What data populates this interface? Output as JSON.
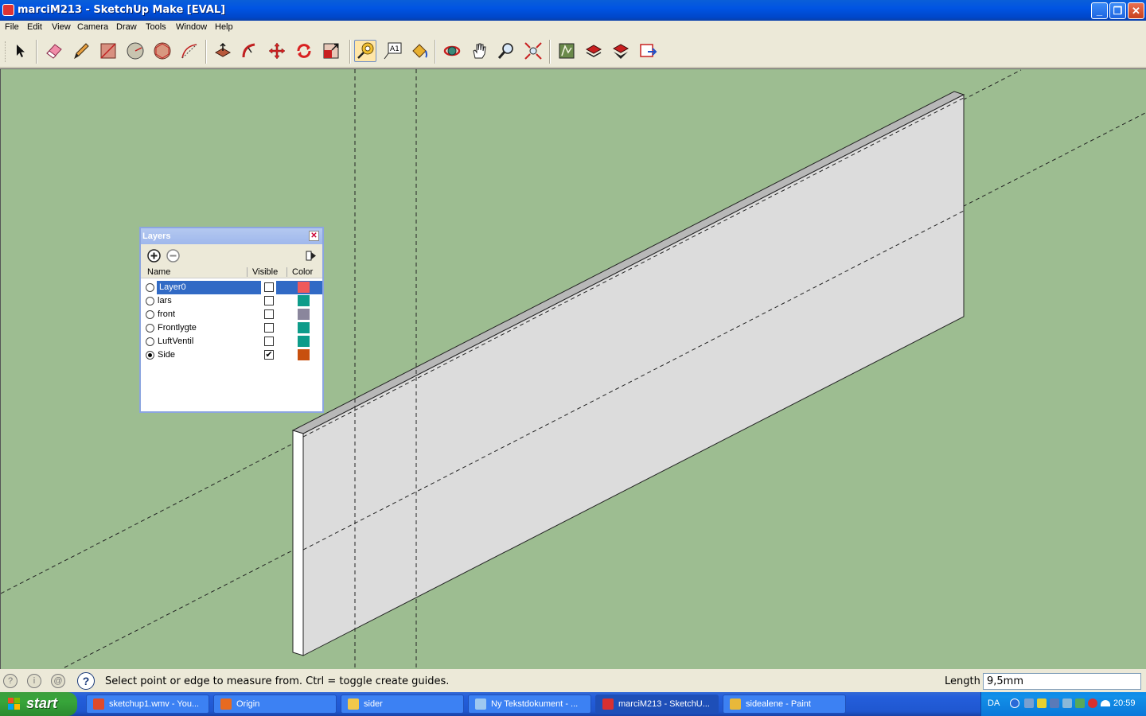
{
  "window": {
    "title": "marciM213 - SketchUp Make [EVAL]",
    "controls": [
      "minimize",
      "restore",
      "close"
    ]
  },
  "menu": [
    "File",
    "Edit",
    "View",
    "Camera",
    "Draw",
    "Tools",
    "Window",
    "Help"
  ],
  "toolbar": {
    "tools": [
      {
        "name": "select-tool",
        "icon": "arrow-icon"
      },
      {
        "name": "eraser-tool",
        "icon": "eraser-icon"
      },
      {
        "name": "pencil-tool",
        "icon": "pencil-icon"
      },
      {
        "name": "rectangle-tool",
        "icon": "rectangle-icon"
      },
      {
        "name": "circle-tool",
        "icon": "circle-icon"
      },
      {
        "name": "polygon-tool",
        "icon": "polygon-icon"
      },
      {
        "name": "arc-tool",
        "icon": "arc-icon"
      },
      {
        "name": "push-pull-tool",
        "icon": "push-pull-icon"
      },
      {
        "name": "follow-me-tool",
        "icon": "follow-me-icon"
      },
      {
        "name": "move-tool",
        "icon": "move-icon"
      },
      {
        "name": "rotate-tool",
        "icon": "rotate-icon"
      },
      {
        "name": "scale-tool",
        "icon": "scale-icon"
      },
      {
        "name": "tape-measure-tool",
        "icon": "tape-measure-icon",
        "active": true
      },
      {
        "name": "text-tool",
        "icon": "text-icon"
      },
      {
        "name": "paint-bucket-tool",
        "icon": "paint-bucket-icon"
      },
      {
        "name": "orbit-tool",
        "icon": "orbit-icon"
      },
      {
        "name": "pan-tool",
        "icon": "hand-icon"
      },
      {
        "name": "zoom-tool",
        "icon": "zoom-icon"
      },
      {
        "name": "zoom-extents-tool",
        "icon": "zoom-extents-icon"
      },
      {
        "name": "3d-warehouse-tool",
        "icon": "warehouse-icon"
      },
      {
        "name": "share-model-tool",
        "icon": "share-model-icon"
      },
      {
        "name": "get-models-tool",
        "icon": "get-models-icon"
      },
      {
        "name": "extension-warehouse-tool",
        "icon": "extension-icon"
      }
    ],
    "text_tool_glyph": "A1"
  },
  "layers_panel": {
    "title": "Layers",
    "close_glyph": "✕",
    "columns": {
      "name": "Name",
      "visible": "Visible",
      "color": "Color"
    },
    "rows": [
      {
        "name": "Layer0",
        "active": false,
        "visible": false,
        "color": "#F05A5A",
        "selected": true
      },
      {
        "name": "lars",
        "active": false,
        "visible": false,
        "color": "#0E9C8A",
        "selected": false
      },
      {
        "name": "front",
        "active": false,
        "visible": false,
        "color": "#8A869C",
        "selected": false
      },
      {
        "name": "Frontlygte",
        "active": false,
        "visible": false,
        "color": "#0E9C8A",
        "selected": false
      },
      {
        "name": "LuftVentil",
        "active": false,
        "visible": false,
        "color": "#0E9C8A",
        "selected": false
      },
      {
        "name": "Side",
        "active": true,
        "visible": true,
        "color": "#C8500E",
        "selected": false
      }
    ]
  },
  "statusbar": {
    "message": "Select point or edge to measure from.  Ctrl = toggle create guides.",
    "vcb_label": "Length",
    "vcb_value": "9,5mm"
  },
  "taskbar": {
    "start_label": "start",
    "tasks": [
      {
        "label": "sketchup1.wmv - You...",
        "icon_color": "#E04A2A",
        "active": false
      },
      {
        "label": "Origin",
        "icon_color": "#E86A20",
        "active": false
      },
      {
        "label": "sider",
        "icon_color": "#F2C84A",
        "active": false
      },
      {
        "label": "Ny Tekstdokument - ...",
        "icon_color": "#9EC8F0",
        "active": false
      },
      {
        "label": "marciM213 - SketchU...",
        "icon_color": "#D83030",
        "active": true
      },
      {
        "label": "sidealene - Paint",
        "icon_color": "#E8B83A",
        "active": false
      }
    ],
    "language": "DA",
    "clock": "20:59"
  },
  "colors": {
    "viewport_bg": "#9DBD91",
    "selection": "#316AC5"
  }
}
